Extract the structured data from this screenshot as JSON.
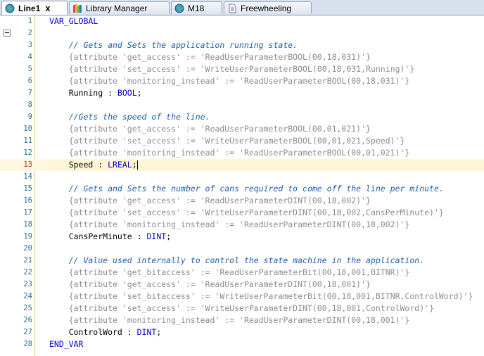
{
  "tabs": [
    {
      "label": "Line1",
      "active": true,
      "icon": "globe-icon"
    },
    {
      "label": "Library Manager",
      "active": false,
      "icon": "library-icon"
    },
    {
      "label": "M18",
      "active": false,
      "icon": "globe-icon"
    },
    {
      "label": "Freewheeling",
      "active": false,
      "icon": "document-icon"
    }
  ],
  "close_label": "x",
  "current_line": 13,
  "lines": [
    {
      "n": "1",
      "text": "VAR_GLOBAL",
      "kind": "kw"
    },
    {
      "n": "2",
      "text": "",
      "kind": "plain"
    },
    {
      "n": "3",
      "text": "    // Gets and Sets the application running state.",
      "kind": "comment"
    },
    {
      "n": "4",
      "text": "    {attribute 'get_access' := 'ReadUserParameterBOOL(00,18,031)'}",
      "kind": "attr"
    },
    {
      "n": "5",
      "text": "    {attribute 'set_access' := 'WriteUserParameterBOOL(00,18,031,Running)'}",
      "kind": "attr"
    },
    {
      "n": "6",
      "text": "    {attribute 'monitoring_instead' := 'ReadUserParameterBOOL(00,18,031)'}",
      "kind": "attr"
    },
    {
      "n": "7",
      "text": "    Running : BOOL;",
      "kind": "decl",
      "name": "Running",
      "type": "BOOL"
    },
    {
      "n": "8",
      "text": "",
      "kind": "plain"
    },
    {
      "n": "9",
      "text": "    //Gets the speed of the line.",
      "kind": "comment"
    },
    {
      "n": "10",
      "text": "    {attribute 'get_access' := 'ReadUserParameterBOOL(00,01,021)'}",
      "kind": "attr"
    },
    {
      "n": "11",
      "text": "    {attribute 'set_access' := 'WriteUserParameterBOOL(00,01,021,Speed)'}",
      "kind": "attr"
    },
    {
      "n": "12",
      "text": "    {attribute 'monitoring_instead' := 'ReadUserParameterBOOL(00,01,021)'}",
      "kind": "attr"
    },
    {
      "n": "13",
      "text": "    Speed : LREAL;",
      "kind": "decl",
      "name": "Speed",
      "type": "LREAL"
    },
    {
      "n": "14",
      "text": "",
      "kind": "plain"
    },
    {
      "n": "15",
      "text": "    // Gets and Sets the number of cans required to come off the line per minute.",
      "kind": "comment"
    },
    {
      "n": "16",
      "text": "    {attribute 'get_access' := 'ReadUserParameterDINT(00,18,002)'}",
      "kind": "attr"
    },
    {
      "n": "17",
      "text": "    {attribute 'set_access' := 'WriteUserParameterDINT(00,18,002,CansPerMinute)'}",
      "kind": "attr"
    },
    {
      "n": "18",
      "text": "    {attribute 'monitoring_instead' := 'ReadUserParameterDINT(00,18,002)'}",
      "kind": "attr"
    },
    {
      "n": "19",
      "text": "    CansPerMinute : DINT;",
      "kind": "decl",
      "name": "CansPerMinute",
      "type": "DINT"
    },
    {
      "n": "20",
      "text": "",
      "kind": "plain"
    },
    {
      "n": "21",
      "text": "    // Value used internally to control the state machine in the application.",
      "kind": "comment"
    },
    {
      "n": "22",
      "text": "    {attribute 'get_bitaccess' := 'ReadUserParameterBit(00,18,001,BITNR)'}",
      "kind": "attr"
    },
    {
      "n": "23",
      "text": "    {attribute 'get_access' := 'ReadUserParameterDINT(00,18,001)'}",
      "kind": "attr"
    },
    {
      "n": "24",
      "text": "    {attribute 'set_bitaccess' := 'WriteUserParameterBit(00,18,001,BITNR,ControlWord)'}",
      "kind": "attr"
    },
    {
      "n": "25",
      "text": "    {attribute 'set_access' := 'WriteUserParameterDINT(00,18,001,ControlWord)'}",
      "kind": "attr"
    },
    {
      "n": "26",
      "text": "    {attribute 'monitoring_instead' := 'ReadUserParameterDINT(00,18,001)'}",
      "kind": "attr"
    },
    {
      "n": "27",
      "text": "    ControlWord : DINT;",
      "kind": "decl",
      "name": "ControlWord",
      "type": "DINT"
    },
    {
      "n": "28",
      "text": "END_VAR",
      "kind": "kw"
    }
  ],
  "colors": {
    "comment": "#1f5ea8",
    "attribute": "#8c8c8c",
    "keyword": "#0000cc",
    "line_number": "#2d6e8a",
    "current_line_number": "#c0392b",
    "current_line_bg": "#fdf6d6"
  }
}
